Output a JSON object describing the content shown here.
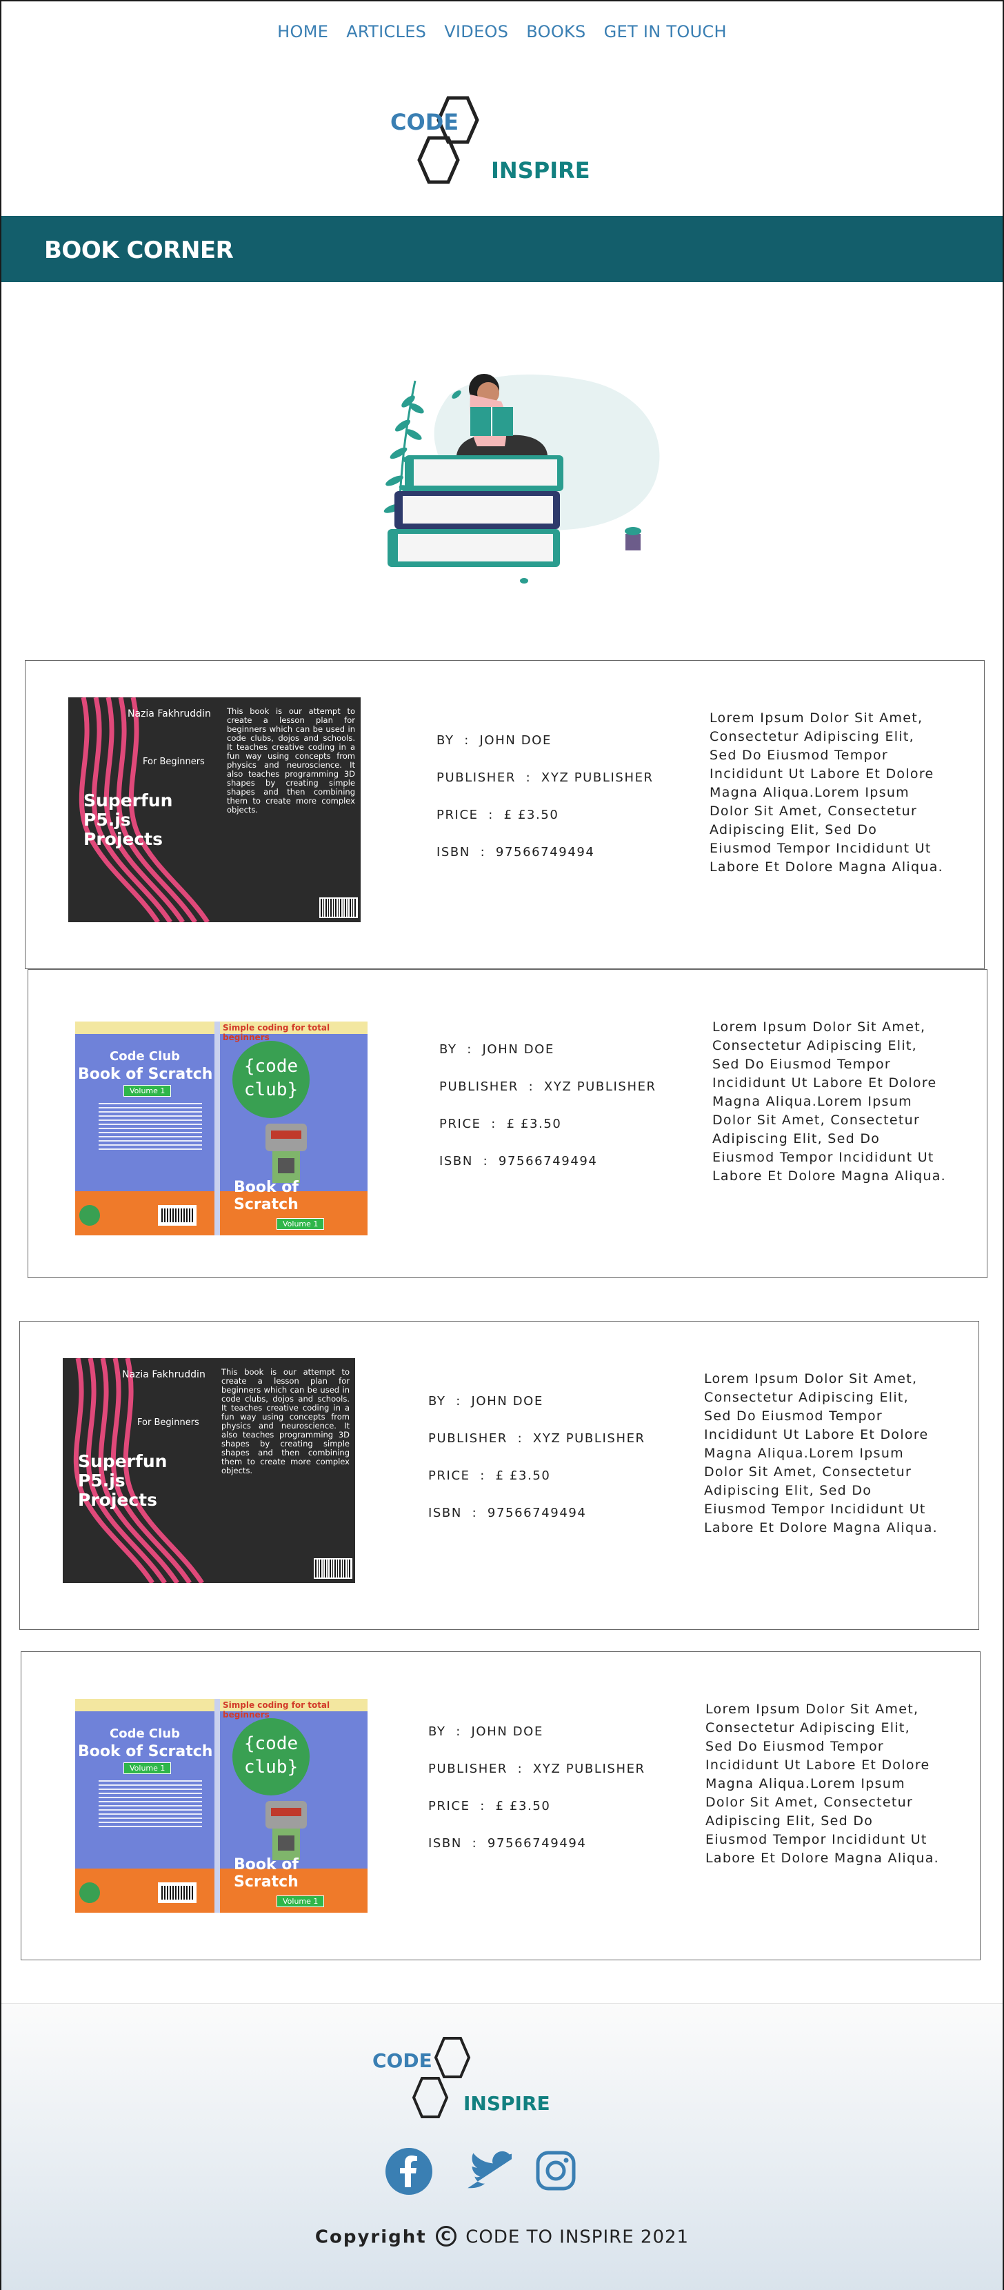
{
  "nav": {
    "items": [
      {
        "label": "HOME"
      },
      {
        "label": "ARTICLES"
      },
      {
        "label": "VIDEOS"
      },
      {
        "label": "BOOKS"
      },
      {
        "label": "GET IN TOUCH"
      }
    ]
  },
  "logo": {
    "word1": "CODE",
    "word2": "INSPIRE"
  },
  "banner": {
    "title": "BOOK CORNER"
  },
  "books": [
    {
      "cover": "p5",
      "by_label": "BY",
      "author": "JOHN DOE",
      "publisher_label": "PUBLISHER",
      "publisher": "XYZ PUBLISHER",
      "price_label": "PRICE",
      "price": "£ £3.50",
      "isbn_label": "ISBN",
      "isbn": "97566749494",
      "description": "Lorem Ipsum Dolor Sit Amet, Consectetur Adipiscing Elit, Sed Do Eiusmod Tempor Incididunt Ut Labore Et Dolore Magna Aliqua.Lorem Ipsum Dolor Sit Amet, Consectetur Adipiscing Elit, Sed Do Eiusmod Tempor Incididunt Ut Labore Et Dolore Magna Aliqua."
    },
    {
      "cover": "scratch",
      "by_label": "BY",
      "author": "JOHN DOE",
      "publisher_label": "PUBLISHER",
      "publisher": "XYZ PUBLISHER",
      "price_label": "PRICE",
      "price": "£ £3.50",
      "isbn_label": "ISBN",
      "isbn": "97566749494",
      "description": "Lorem Ipsum Dolor Sit Amet, Consectetur Adipiscing Elit, Sed Do Eiusmod Tempor Incididunt Ut Labore Et Dolore Magna Aliqua.Lorem Ipsum Dolor Sit Amet, Consectetur Adipiscing Elit, Sed Do Eiusmod Tempor Incididunt Ut Labore Et Dolore Magna Aliqua."
    },
    {
      "cover": "p5",
      "by_label": "BY",
      "author": "JOHN DOE",
      "publisher_label": "PUBLISHER",
      "publisher": "XYZ PUBLISHER",
      "price_label": "PRICE",
      "price": "£ £3.50",
      "isbn_label": "ISBN",
      "isbn": "97566749494",
      "description": "Lorem Ipsum Dolor Sit Amet, Consectetur Adipiscing Elit, Sed Do Eiusmod Tempor Incididunt Ut Labore Et Dolore Magna Aliqua.Lorem Ipsum Dolor Sit Amet, Consectetur Adipiscing Elit, Sed Do Eiusmod Tempor Incididunt Ut Labore Et Dolore Magna Aliqua."
    },
    {
      "cover": "scratch",
      "by_label": "BY",
      "author": "JOHN DOE",
      "publisher_label": "PUBLISHER",
      "publisher": "XYZ PUBLISHER",
      "price_label": "PRICE",
      "price": "£ £3.50",
      "isbn_label": "ISBN",
      "isbn": "97566749494",
      "description": "Lorem Ipsum Dolor Sit Amet, Consectetur Adipiscing Elit, Sed Do Eiusmod Tempor Incididunt Ut Labore Et Dolore Magna Aliqua.Lorem Ipsum Dolor Sit Amet, Consectetur Adipiscing Elit, Sed Do Eiusmod Tempor Incididunt Ut Labore Et Dolore Magna Aliqua."
    }
  ],
  "covers": {
    "p5": {
      "author": "Nazia Fakhruddin",
      "audience": "For Beginners",
      "title_line1": "Superfun",
      "title_line2": "P5.js",
      "title_line3": "Projects",
      "blurb": "This book is our attempt to create a lesson plan for beginners which can be used in code clubs, dojos and schools. It teaches creative coding in a fun way using concepts from physics and neuroscience. It also teaches programming 3D shapes by creating simple shapes and then combining them to create more complex objects."
    },
    "scratch": {
      "tagline": "Simple coding for total beginners",
      "brand": "Code Club",
      "title": "Book of Scratch",
      "volume": "Volume 1",
      "badge_line1": "{code",
      "badge_line2": "club}"
    }
  },
  "footer": {
    "social": [
      {
        "name": "facebook",
        "color": "#3a7fb3"
      },
      {
        "name": "twitter",
        "color": "#3a7fb3"
      },
      {
        "name": "instagram",
        "color": "#3a7fb3"
      }
    ],
    "copyright_word": "Copyright",
    "copyright_symbol": "C",
    "copyright_text": "CODE TO INSPIRE  2021"
  },
  "colors": {
    "nav_link": "#3a7fb3",
    "banner": "#135e6b",
    "logo_code": "#3a7fb3",
    "logo_inspire": "#128080"
  }
}
